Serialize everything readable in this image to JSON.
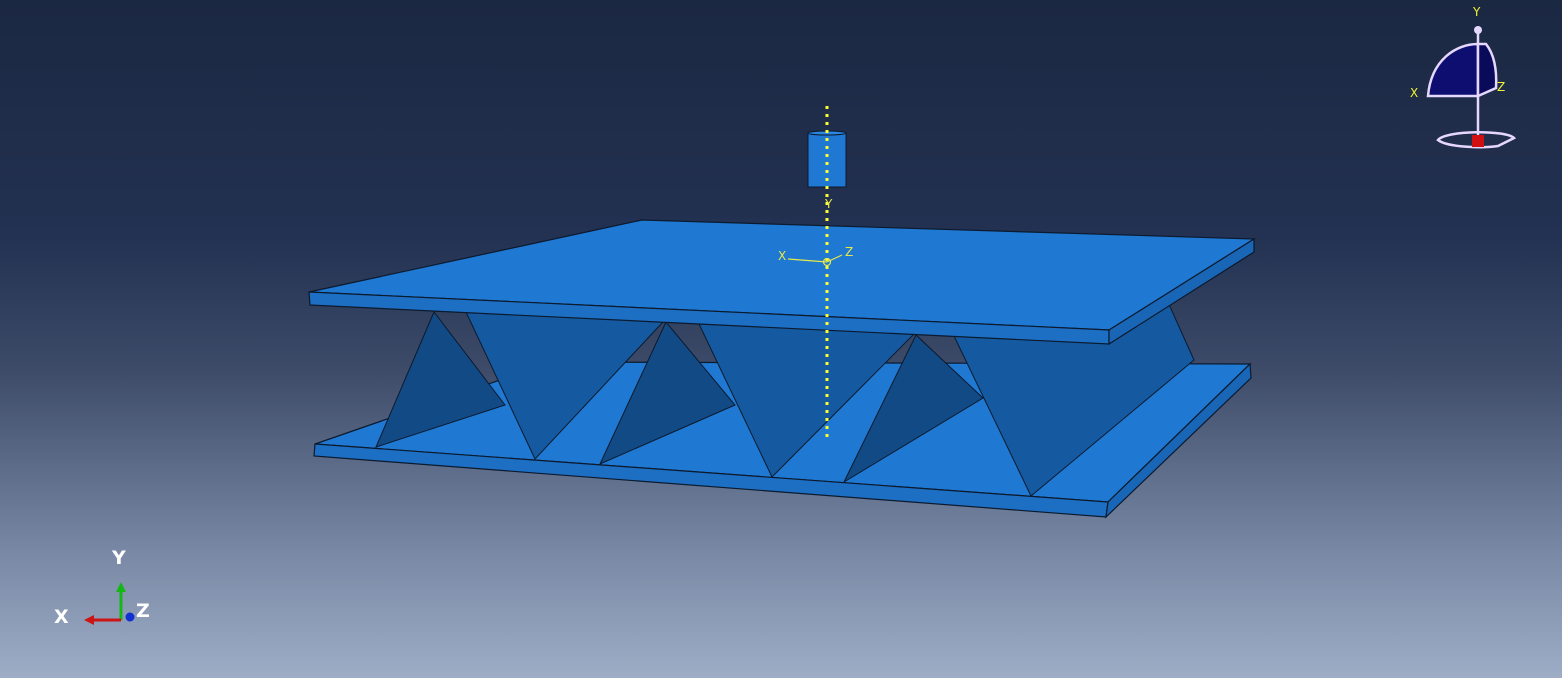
{
  "colors": {
    "part_fill": "#1f78d1",
    "part_edge": "#0b1a2e",
    "web_front": "#155aa0",
    "web_side": "#124a86",
    "reference_axis": "#ffff30",
    "local_csys": "#e8e84a",
    "axis_x": "#cc1414",
    "axis_y": "#14b814",
    "axis_z": "#1030d0",
    "view_cube_fill": "#0e0e70",
    "view_cube_edge": "#e6d7ff",
    "view_cube_marker": "#d01010"
  },
  "local_csys": {
    "x": "X",
    "y": "Y",
    "z": "Z"
  },
  "triad": {
    "x": "X",
    "y": "Y",
    "z": "Z"
  },
  "view_cube": {
    "x": "X",
    "y": "Y",
    "z": "Z"
  }
}
